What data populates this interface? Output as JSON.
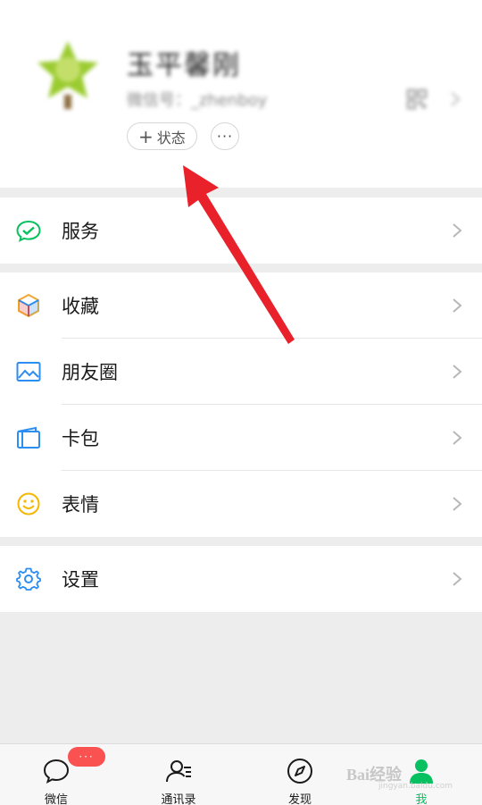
{
  "profile": {
    "nickname": "玉平馨刚",
    "wxid": "微信号：_zhenboy",
    "status_label": "状态",
    "status_plus": "+",
    "more_label": "···"
  },
  "menu": {
    "services": {
      "label": "服务",
      "icon": "wechat-pay-icon"
    },
    "favorites": {
      "label": "收藏",
      "icon": "cube-icon"
    },
    "moments": {
      "label": "朋友圈",
      "icon": "image-icon"
    },
    "cards": {
      "label": "卡包",
      "icon": "wallet-icon"
    },
    "stickers": {
      "label": "表情",
      "icon": "smiley-icon"
    },
    "settings": {
      "label": "设置",
      "icon": "gear-icon"
    }
  },
  "tabbar": {
    "chats": {
      "label": "微信",
      "badge": "···"
    },
    "contacts": {
      "label": "通讯录"
    },
    "discover": {
      "label": "发现"
    },
    "me": {
      "label": "我"
    }
  },
  "watermark": {
    "text": "Bai经验",
    "sub": "jingyan.baidu.com"
  },
  "colors": {
    "accent_green": "#07c160",
    "badge_red": "#fa5151",
    "arrow_red": "#e8212b",
    "background": "#ededed"
  }
}
